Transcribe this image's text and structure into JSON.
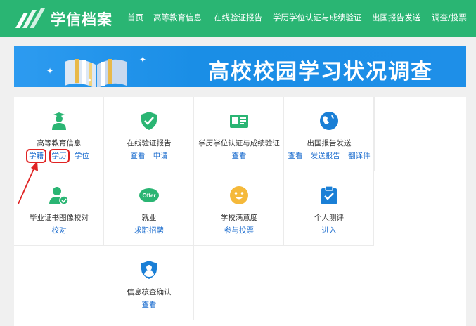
{
  "header": {
    "brand": "学信档案",
    "nav": [
      "首页",
      "高等教育信息",
      "在线验证报告",
      "学历学位认证与成绩验证",
      "出国报告发送",
      "调查/投票"
    ]
  },
  "banner": {
    "title": "高校校园学习状况调查"
  },
  "cards": [
    {
      "title": "高等教育信息",
      "links": [
        "学籍",
        "学历",
        "学位"
      ],
      "icon": "graduate-icon"
    },
    {
      "title": "在线验证报告",
      "links": [
        "查看",
        "申请"
      ],
      "icon": "shield-check-icon"
    },
    {
      "title": "学历学位认证与成绩验证",
      "links": [
        "查看"
      ],
      "icon": "id-card-icon"
    },
    {
      "title": "出国报告发送",
      "links": [
        "查看",
        "发送报告",
        "翻译件"
      ],
      "icon": "globe-icon"
    },
    {
      "title": "毕业证书图像校对",
      "links": [
        "校对"
      ],
      "icon": "user-check-icon"
    },
    {
      "title": "就业",
      "links": [
        "求职招聘"
      ],
      "icon": "offer-icon"
    },
    {
      "title": "学校满意度",
      "links": [
        "参与投票"
      ],
      "icon": "smile-icon"
    },
    {
      "title": "个人测评",
      "links": [
        "进入"
      ],
      "icon": "clipboard-check-icon"
    },
    {
      "title": "信息核查确认",
      "links": [
        "查看"
      ],
      "icon": "user-shield-icon"
    }
  ],
  "colors": {
    "header": "#2ab573",
    "banner": "#1a8ee6",
    "link": "#1e6ecf",
    "highlight": "#e02424"
  }
}
